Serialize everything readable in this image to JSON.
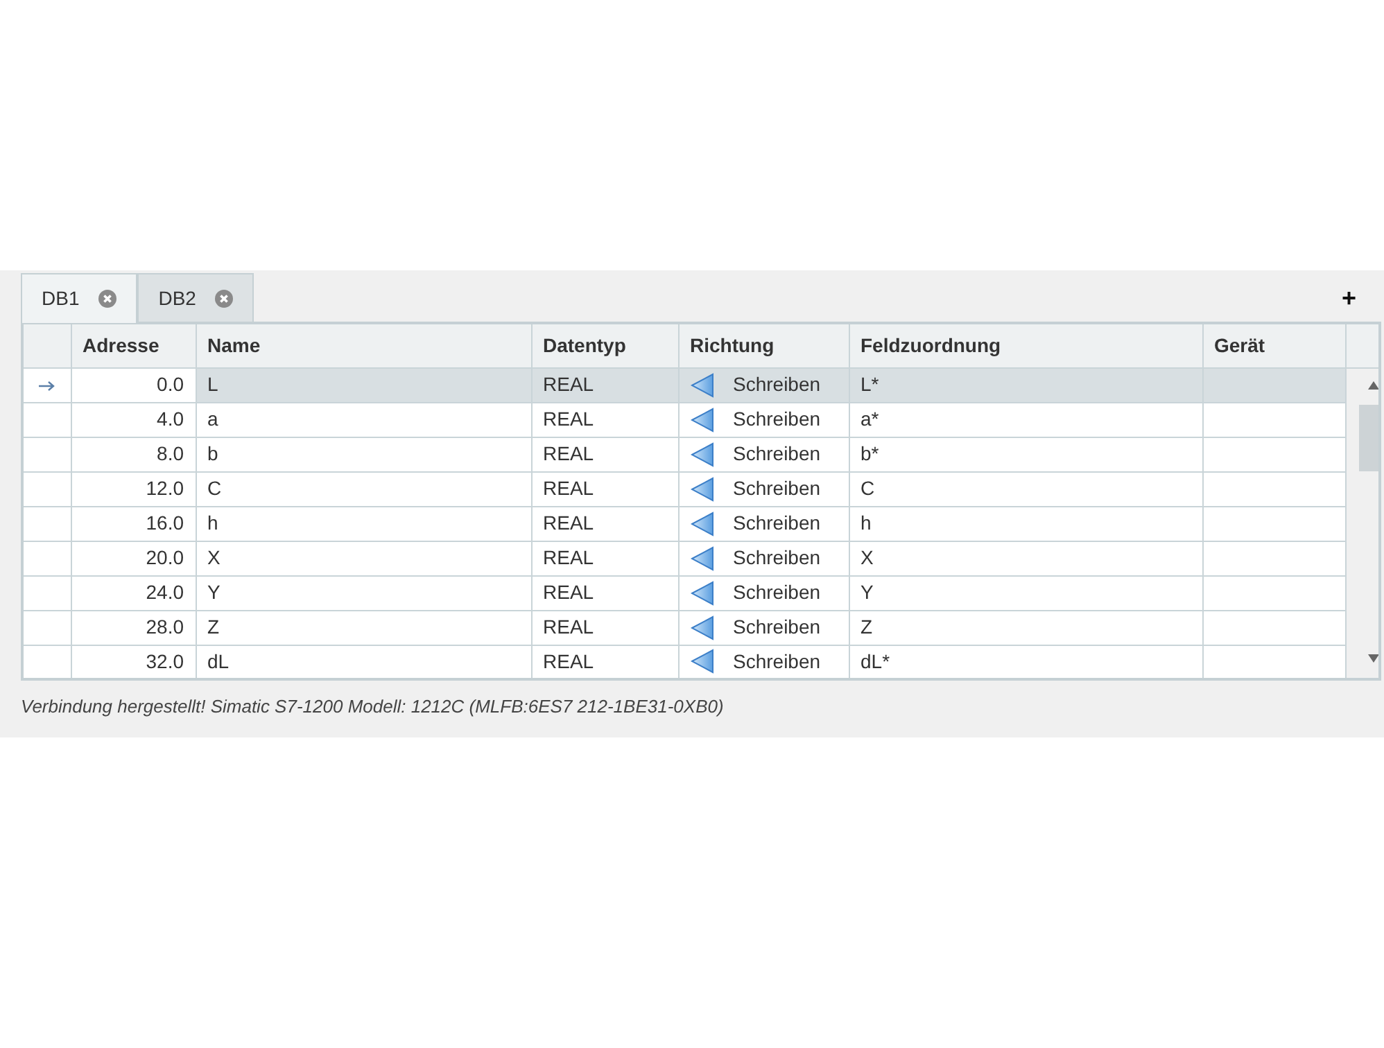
{
  "tabs": [
    {
      "label": "DB1",
      "selected": true
    },
    {
      "label": "DB2",
      "selected": false
    }
  ],
  "add_button": "+",
  "table": {
    "columns": [
      "Adresse",
      "Name",
      "Datentyp",
      "Richtung",
      "Feldzuordnung",
      "Gerät"
    ],
    "rows": [
      {
        "address": "0.0",
        "name": "L",
        "datatype": "REAL",
        "direction": "Schreiben",
        "field": "L*",
        "selected": true
      },
      {
        "address": "4.0",
        "name": "a",
        "datatype": "REAL",
        "direction": "Schreiben",
        "field": "a*",
        "selected": false
      },
      {
        "address": "8.0",
        "name": "b",
        "datatype": "REAL",
        "direction": "Schreiben",
        "field": "b*",
        "selected": false
      },
      {
        "address": "12.0",
        "name": "C",
        "datatype": "REAL",
        "direction": "Schreiben",
        "field": "C",
        "selected": false
      },
      {
        "address": "16.0",
        "name": "h",
        "datatype": "REAL",
        "direction": "Schreiben",
        "field": "h",
        "selected": false
      },
      {
        "address": "20.0",
        "name": "X",
        "datatype": "REAL",
        "direction": "Schreiben",
        "field": "X",
        "selected": false
      },
      {
        "address": "24.0",
        "name": "Y",
        "datatype": "REAL",
        "direction": "Schreiben",
        "field": "Y",
        "selected": false
      },
      {
        "address": "28.0",
        "name": "Z",
        "datatype": "REAL",
        "direction": "Schreiben",
        "field": "Z",
        "selected": false
      },
      {
        "address": "32.0",
        "name": "dL",
        "datatype": "REAL",
        "direction": "Schreiben",
        "field": "dL*",
        "selected": false
      }
    ]
  },
  "status_bar": "Verbindung hergestellt! Simatic S7-1200 Modell: 1212C (MLFB:6ES7 212-1BE31-0XB0)"
}
